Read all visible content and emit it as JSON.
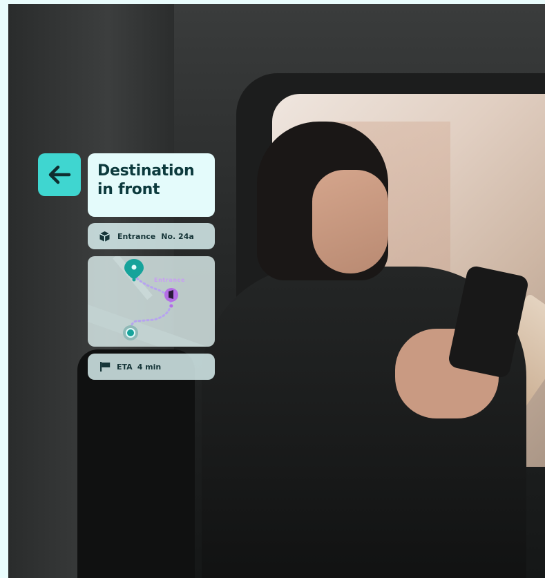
{
  "title": {
    "line1": "Destination",
    "line2": "in front"
  },
  "entrance": {
    "label": "Entrance",
    "number": "No. 24a"
  },
  "map": {
    "entrance_label": "Entrance"
  },
  "eta": {
    "label": "ETA",
    "value": "4 min"
  },
  "icons": {
    "back": "arrow-left-icon",
    "entrance": "package-box-icon",
    "eta": "flag-icon",
    "destination_pin": "map-pin-icon",
    "entrance_pin": "door-pin-icon",
    "origin": "location-dot-icon"
  },
  "colors": {
    "accent": "#3fd6d0",
    "card": "#e4fbfb",
    "title_text": "#0c3a3d",
    "route": "#b7a3f0",
    "pin_teal": "#17a39b",
    "pin_purple": "#b46ee6"
  }
}
